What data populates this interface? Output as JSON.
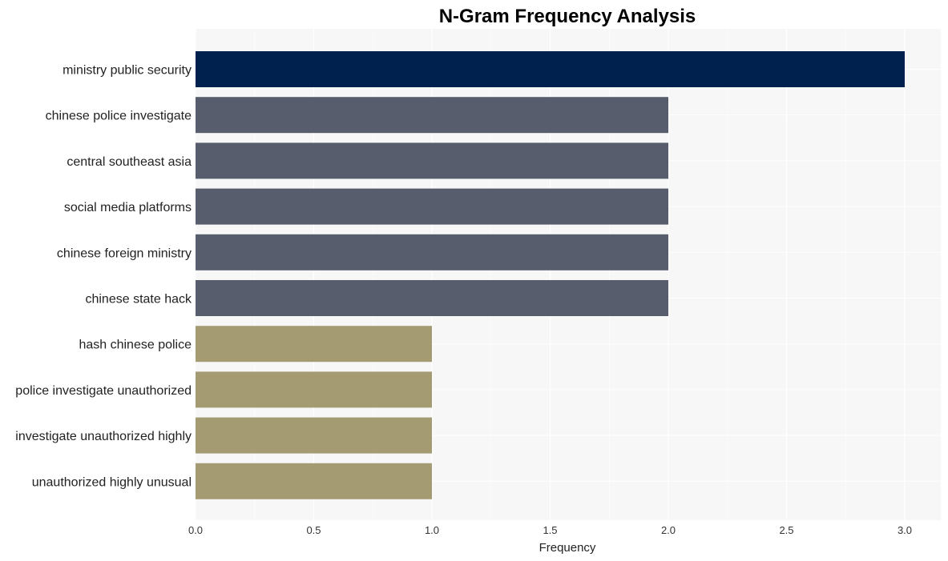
{
  "chart_data": {
    "type": "bar",
    "orientation": "horizontal",
    "title": "N-Gram Frequency Analysis",
    "xlabel": "Frequency",
    "ylabel": "",
    "xlim": [
      0,
      3.15
    ],
    "xticks": [
      0.0,
      0.5,
      1.0,
      1.5,
      2.0,
      2.5,
      3.0
    ],
    "xtick_labels": [
      "0.0",
      "0.5",
      "1.0",
      "1.5",
      "2.0",
      "2.5",
      "3.0"
    ],
    "grid": true,
    "legend": "none",
    "categories": [
      "ministry public security",
      "chinese police investigate",
      "central southeast asia",
      "social media platforms",
      "chinese foreign ministry",
      "chinese state hack",
      "hash chinese police",
      "police investigate unauthorized",
      "investigate unauthorized highly",
      "unauthorized highly unusual"
    ],
    "values": [
      3,
      2,
      2,
      2,
      2,
      2,
      1,
      1,
      1,
      1
    ],
    "colors": [
      "#00214d",
      "#575d6d",
      "#575d6d",
      "#575d6d",
      "#575d6d",
      "#575d6d",
      "#a59b73",
      "#a59b73",
      "#a59b73",
      "#a59b73"
    ],
    "background_color": "#f7f7f7",
    "grid_color": "#ffffff"
  }
}
